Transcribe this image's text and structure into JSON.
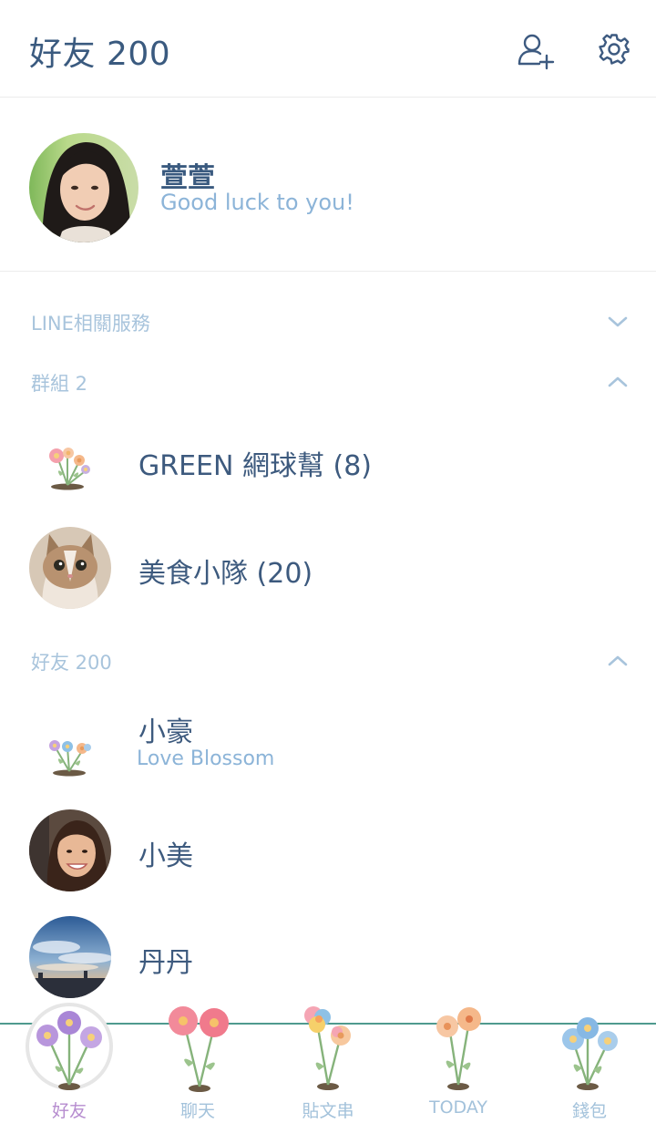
{
  "header": {
    "title": "好友 200",
    "add_friend_icon": "add-friend-icon",
    "settings_icon": "gear-icon"
  },
  "profile": {
    "name": "萱萱",
    "status": "Good luck to you!"
  },
  "sections": {
    "line_services": {
      "label": "LINE相關服務",
      "state": "collapsed"
    },
    "groups": {
      "label": "群組 2",
      "state": "expanded"
    },
    "friends": {
      "label": "好友 200",
      "state": "expanded"
    }
  },
  "groups": [
    {
      "name": "GREEN 網球幫 (8)"
    },
    {
      "name": "美食小隊 (20)"
    }
  ],
  "friends": [
    {
      "name": "小豪",
      "status": "Love Blossom"
    },
    {
      "name": "小美"
    },
    {
      "name": "丹丹"
    }
  ],
  "tabs": [
    {
      "label": "好友",
      "active": true
    },
    {
      "label": "聊天"
    },
    {
      "label": "貼文串"
    },
    {
      "label": "TODAY"
    },
    {
      "label": "錢包"
    }
  ],
  "colors": {
    "title": "#3a5a7f",
    "accent_light": "#8cb4d8",
    "section_label": "#a8c4dc",
    "tab_line": "#4f9a8e",
    "tab_active": "#b68ccf"
  }
}
